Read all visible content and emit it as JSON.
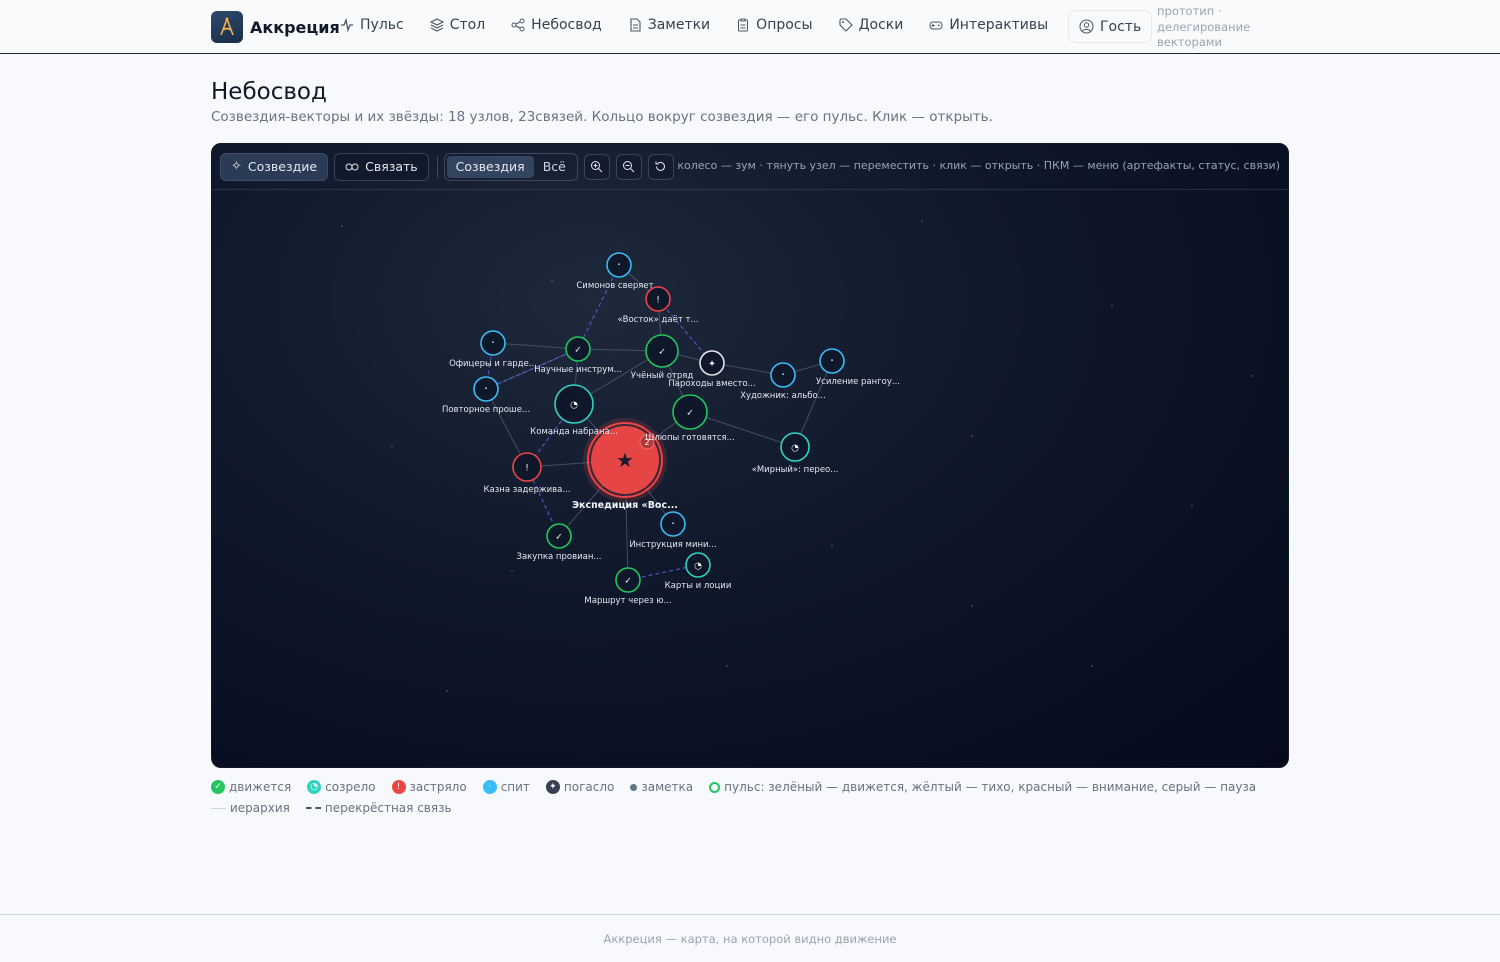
{
  "header": {
    "brand": "Аккреция",
    "nav": [
      {
        "label": "Пульс",
        "icon": "pulse-icon"
      },
      {
        "label": "Стол",
        "icon": "layers-icon"
      },
      {
        "label": "Небосвод",
        "icon": "share-nodes-icon"
      },
      {
        "label": "Заметки",
        "icon": "document-icon"
      },
      {
        "label": "Опросы",
        "icon": "clipboard-icon"
      },
      {
        "label": "Доски",
        "icon": "tag-icon"
      },
      {
        "label": "Интерактивы",
        "icon": "gamepad-icon"
      }
    ],
    "guest_label": "Гость",
    "proto_note": "прототип · делегирование векторами"
  },
  "page": {
    "title": "Небосвод",
    "subtitle": "Созвездия-векторы и их звёзды: 18 узлов, 23связей. Кольцо вокруг созвездия — его пульс. Клик — открыть."
  },
  "toolbar": {
    "constellation_btn": "Созвездие",
    "link_btn": "Связать",
    "seg_constellations": "Созвездия",
    "seg_all": "Всё",
    "hint": "колесо — зум · тянуть узел — переместить · клик — открыть · ПКМ — меню (артефакты, статус, связи)"
  },
  "colors": {
    "moving": "#22c55e",
    "ripe": "#2dd4bf",
    "stuck": "#ef4444",
    "sleeping": "#38bdf8",
    "faded": "#e5e7eb",
    "cross_link": "#6366f1"
  },
  "graph": {
    "center": {
      "label": "Экспедиция «Вос...",
      "status": "stuck",
      "glyph": "★"
    },
    "nodes": [
      {
        "id": "n1",
        "label": "Симонов сверяет...",
        "status": "sleeping",
        "glyph": "·"
      },
      {
        "id": "n2",
        "label": "«Восток» даёт т...",
        "status": "stuck",
        "glyph": "!"
      },
      {
        "id": "n3",
        "label": "Офицеры и гарде...",
        "status": "sleeping",
        "glyph": "·"
      },
      {
        "id": "n4",
        "label": "Научные инструм...",
        "status": "moving",
        "glyph": "✓"
      },
      {
        "id": "n5",
        "label": "Учёный отряд",
        "status": "moving",
        "glyph": "✓"
      },
      {
        "id": "n6",
        "label": "Пароходы вместо...",
        "status": "faded",
        "glyph": "✦"
      },
      {
        "id": "n7",
        "label": "Художник: альбо...",
        "status": "sleeping",
        "glyph": "·"
      },
      {
        "id": "n8",
        "label": "Усиление рангоу...",
        "status": "sleeping",
        "glyph": "·"
      },
      {
        "id": "n9",
        "label": "Повторное проше...",
        "status": "sleeping",
        "glyph": "·"
      },
      {
        "id": "n10",
        "label": "Команда набрана...",
        "status": "ripe",
        "glyph": "◔"
      },
      {
        "id": "n11",
        "label": "Шлюпы готовятся...",
        "status": "moving",
        "glyph": "✓"
      },
      {
        "id": "n12",
        "label": "«Мирный»: перео...",
        "status": "ripe",
        "glyph": "◔"
      },
      {
        "id": "n13",
        "label": "Казна задержива...",
        "status": "stuck",
        "glyph": "!"
      },
      {
        "id": "n14",
        "label": "Инструкция мини...",
        "status": "sleeping",
        "glyph": "·"
      },
      {
        "id": "n15",
        "label": "Закупка провиан...",
        "status": "moving",
        "glyph": "✓"
      },
      {
        "id": "n16",
        "label": "Карты и лоции",
        "status": "ripe",
        "glyph": "◔"
      },
      {
        "id": "n17",
        "label": "Маршрут через ю...",
        "status": "moving",
        "glyph": "✓"
      }
    ],
    "badge_count": "2"
  },
  "legend": {
    "moving": "движется",
    "ripe": "созрело",
    "stuck": "застряло",
    "sleeping": "спит",
    "faded": "погасло",
    "note": "заметка",
    "pulse": "пульс: зелёный — движется, жёлтый — тихо, красный — внимание, серый — пауза",
    "hierarchy": "иерархия",
    "cross": "перекрёстная связь"
  },
  "footer": "Аккреция — карта, на которой видно движение"
}
